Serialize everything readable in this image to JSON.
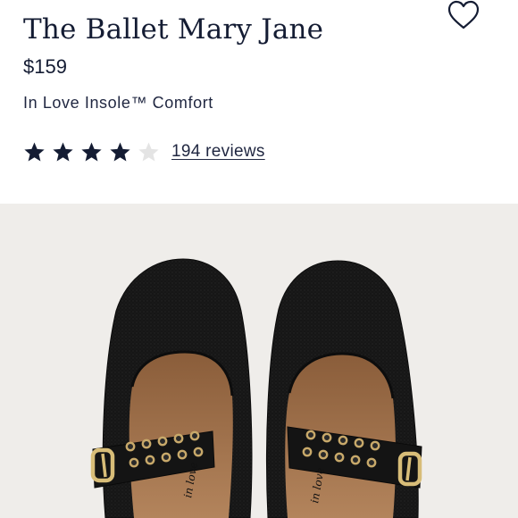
{
  "product": {
    "title": "The Ballet Mary Jane",
    "price": "$159",
    "feature": "In Love Insole™ Comfort",
    "rating": 4,
    "rating_max": 5,
    "reviews_label": "194 reviews"
  },
  "icons": {
    "favorite": "heart-outline-icon",
    "star": "star-icon"
  },
  "image": {
    "insole_lettering": "in love"
  },
  "colors": {
    "text": "#141c33",
    "star_filled": "#141c33",
    "star_empty": "#e4e4e4",
    "image_background": "#efedea",
    "shoe": "#141414",
    "insole": "#a0714a",
    "eyelet": "#c8a96a"
  }
}
